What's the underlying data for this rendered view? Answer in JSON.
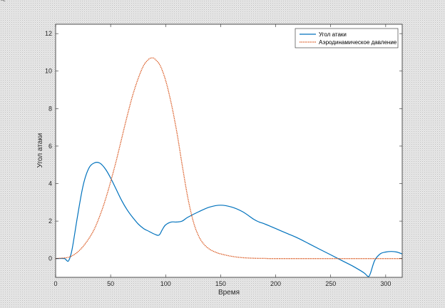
{
  "corner_mark": "Д",
  "chart_data": {
    "type": "line",
    "title": "",
    "xlabel": "Время",
    "ylabel": "Угол атаки",
    "xlim": [
      0,
      315
    ],
    "ylim": [
      -1,
      12.5
    ],
    "xticks": [
      0,
      50,
      100,
      150,
      200,
      250,
      300
    ],
    "yticks": [
      0,
      2,
      4,
      6,
      8,
      10,
      12
    ],
    "grid": false,
    "legend_position": "top-right",
    "series": [
      {
        "name": "Угол атаки",
        "color": "#0072BD",
        "style": "solid",
        "x": [
          0,
          8,
          10,
          12,
          15,
          20,
          25,
          30,
          35,
          40,
          45,
          50,
          55,
          60,
          65,
          70,
          75,
          80,
          85,
          90,
          94,
          97,
          100,
          105,
          110,
          115,
          120,
          130,
          140,
          150,
          160,
          170,
          180,
          185,
          190,
          200,
          210,
          220,
          230,
          240,
          250,
          260,
          270,
          280,
          284,
          286,
          290,
          295,
          300,
          305,
          310,
          315
        ],
        "y": [
          0,
          0,
          -0.1,
          -0.1,
          0.5,
          2.3,
          3.9,
          4.8,
          5.1,
          5.1,
          4.8,
          4.3,
          3.7,
          3.1,
          2.6,
          2.2,
          1.85,
          1.6,
          1.45,
          1.3,
          1.25,
          1.55,
          1.8,
          1.95,
          1.95,
          2.0,
          2.2,
          2.5,
          2.75,
          2.85,
          2.75,
          2.5,
          2.1,
          1.95,
          1.85,
          1.6,
          1.35,
          1.1,
          0.8,
          0.5,
          0.2,
          -0.1,
          -0.4,
          -0.75,
          -0.95,
          -0.8,
          -0.1,
          0.25,
          0.35,
          0.38,
          0.35,
          0.25
        ]
      },
      {
        "name": "Аэродинамическое давление",
        "color": "#D95319",
        "style": "dotted",
        "x": [
          0,
          10,
          15,
          20,
          25,
          30,
          35,
          40,
          45,
          50,
          55,
          60,
          65,
          70,
          75,
          80,
          85,
          88,
          90,
          95,
          100,
          105,
          110,
          115,
          120,
          125,
          130,
          135,
          140,
          145,
          150,
          160,
          170,
          180,
          190,
          200,
          250,
          315
        ],
        "y": [
          0,
          0.05,
          0.15,
          0.35,
          0.65,
          1.05,
          1.55,
          2.25,
          3.1,
          4.1,
          5.2,
          6.4,
          7.6,
          8.7,
          9.6,
          10.3,
          10.65,
          10.7,
          10.65,
          10.3,
          9.5,
          8.3,
          6.8,
          5.0,
          3.3,
          2.0,
          1.2,
          0.75,
          0.5,
          0.35,
          0.25,
          0.12,
          0.05,
          0.02,
          0.01,
          0,
          0,
          0
        ]
      }
    ]
  }
}
